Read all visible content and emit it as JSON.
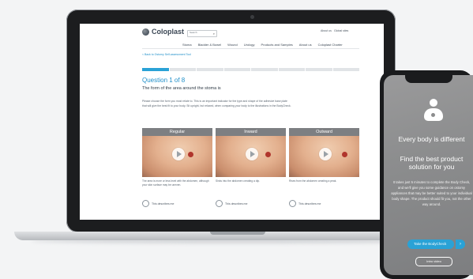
{
  "laptop": {
    "site": {
      "logo_text": "Coloplast",
      "search_label": "Search",
      "search_icon": "search-icon",
      "top_links": [
        "About us",
        "Global sites"
      ],
      "nav_items": [
        "Stoma",
        "Bladder & Bowel",
        "Wound",
        "Urology",
        "Products and Samples",
        "About us",
        "Coloplast Charter"
      ],
      "back_link": "< Back to Ostomy Self-assessment Tool"
    },
    "progress": {
      "total": 8,
      "current": 1
    },
    "question": {
      "number": "Question 1 of 8",
      "title": "The form of the area around the stoma is",
      "instructions": "Please choose the form you most relate to. This is an important indicator for the type and shape of the adhesive base plate that will give the best fit to your body. Sit upright, but relaxed, when comparing your body to the illustrations in the BodyCheck."
    },
    "options": [
      {
        "label": "Regular",
        "description": "The area is more or less level with the abdomen, although your skin surface may be uneven.",
        "choice": "This describes me"
      },
      {
        "label": "Inward",
        "description": "Sinks into the abdomen creating a dip.",
        "choice": "This describes me"
      },
      {
        "label": "Outward",
        "description": "Rises from the abdomen creating a peak.",
        "choice": "This describes me"
      }
    ]
  },
  "phone": {
    "title": "Every body is different",
    "subtitle": "Find the best product solution for you",
    "body": "It takes just 5 minutes to complete the Body Check, and we'll give you some guidance on ostomy appliances that may be better suited to your individual body shape. The product should fit you, not the other way around.",
    "cta": "Take the BodyCheck",
    "secondary": "Intro video"
  },
  "colors": {
    "accent": "#2aa2d6",
    "option_header": "#7d7f82"
  }
}
